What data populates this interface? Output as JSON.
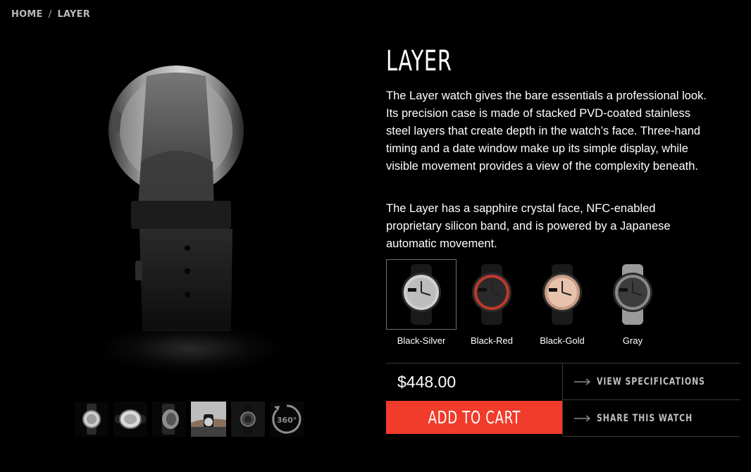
{
  "breadcrumb": {
    "home": "HOME",
    "separator": "/",
    "current": "LAYER"
  },
  "product": {
    "title": "LAYER",
    "description_1": "The Layer watch gives the bare essentials a professional look. Its precision case is made of stacked PVD-coated stainless steel layers that create depth in the watch’s face. Three-hand timing and a date window make up its simple display, while visible movement provides a view of the complexity beneath.",
    "description_2": "The Layer has a sapphire crystal face, NFC-enabled proprietary silicon band, and is powered by  a Japanese automatic movement.",
    "price": "$448.00"
  },
  "variants": [
    {
      "label": "Black-Silver",
      "dial": "#bdbdbd",
      "strap": "#1a1a1a",
      "accent": "#d0d0d0",
      "selected": true
    },
    {
      "label": "Black-Red",
      "dial": "#2a2a2a",
      "strap": "#1a1a1a",
      "accent": "#c0392b",
      "selected": false
    },
    {
      "label": "Black-Gold",
      "dial": "#e7c2ad",
      "strap": "#1a1a1a",
      "accent": "#c99b84",
      "selected": false
    },
    {
      "label": "Gray",
      "dial": "#3c3c3c",
      "strap": "#9a9a9a",
      "accent": "#8a8a8a",
      "selected": false
    }
  ],
  "thumbnails": [
    "front-view",
    "face-view",
    "side-view",
    "wrist-photo",
    "dark-front-view",
    "360-view"
  ],
  "thumb_360_label": "360°",
  "actions": {
    "add_to_cart": "ADD TO CART",
    "view_specs": "VIEW SPECIFICATIONS",
    "share": "SHARE THIS WATCH"
  },
  "colors": {
    "accent": "#f13b2b",
    "background": "#000000",
    "muted_text": "#bdbdbd"
  },
  "icons": {
    "link_arrow": "long-arrow-right-icon",
    "rotate": "rotate-360-icon"
  }
}
